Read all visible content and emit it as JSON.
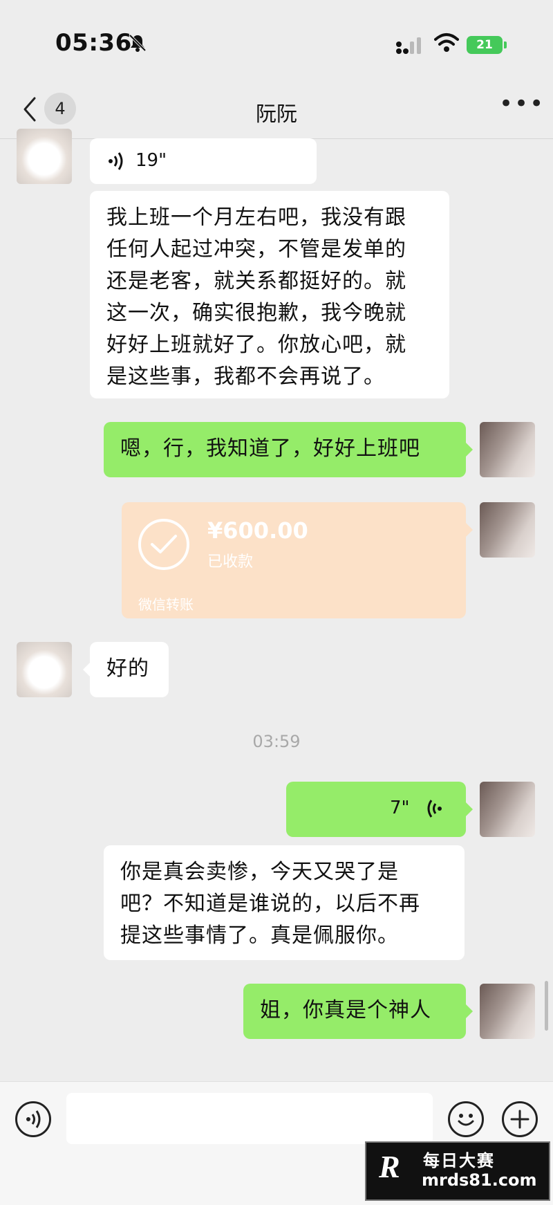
{
  "status_bar": {
    "time": "05:36",
    "battery": "21",
    "icons": [
      "bell-slash-icon",
      "signal-icon",
      "wifi-icon",
      "battery-icon"
    ]
  },
  "nav": {
    "back_icon": "chevron-left-icon",
    "unread_count": "4",
    "title": "阮阮",
    "more_icon": "more-dots-icon"
  },
  "messages": [
    {
      "sender": "friend",
      "type": "voice",
      "duration": "19\""
    },
    {
      "sender": "friend",
      "type": "text",
      "text": "我上班一个月左右吧，我没有跟\n任何人起过冲突，不管是发单的\n还是老客，就关系都挺好的。就\n这一次，确实很抱歉，我今晚就\n好好上班就好了。你放心吧，就\n是这些事，我都不会再说了。"
    },
    {
      "sender": "me",
      "type": "text",
      "text": "嗯，行，我知道了，好好上班吧"
    },
    {
      "sender": "me",
      "type": "transfer",
      "amount": "¥600.00",
      "status": "已收款",
      "brand": "微信转账"
    },
    {
      "sender": "friend",
      "type": "text",
      "text": "好的"
    },
    {
      "type": "timestamp",
      "text": "03:59"
    },
    {
      "sender": "me",
      "type": "voice",
      "duration": "7\""
    },
    {
      "sender": "me",
      "type": "text",
      "text": "你是真会卖惨，今天又哭了是\n吧？不知道是谁说的，以后不再\n提这些事情了。真是佩服你。"
    },
    {
      "sender": "me",
      "type": "text",
      "text": "姐，你真是个神人"
    }
  ],
  "input_bar": {
    "voice_icon": "voice-mode-icon",
    "text_value": "",
    "emoji_icon": "emoji-icon",
    "plus_icon": "plus-icon"
  },
  "watermark": {
    "logo_letter": "R",
    "title": "每日大赛",
    "url": "mrds81.com"
  },
  "colors": {
    "background": "#ededed",
    "my_bubble": "#95ec69",
    "friend_bubble": "#ffffff",
    "transfer_card": "#fce1c8"
  }
}
